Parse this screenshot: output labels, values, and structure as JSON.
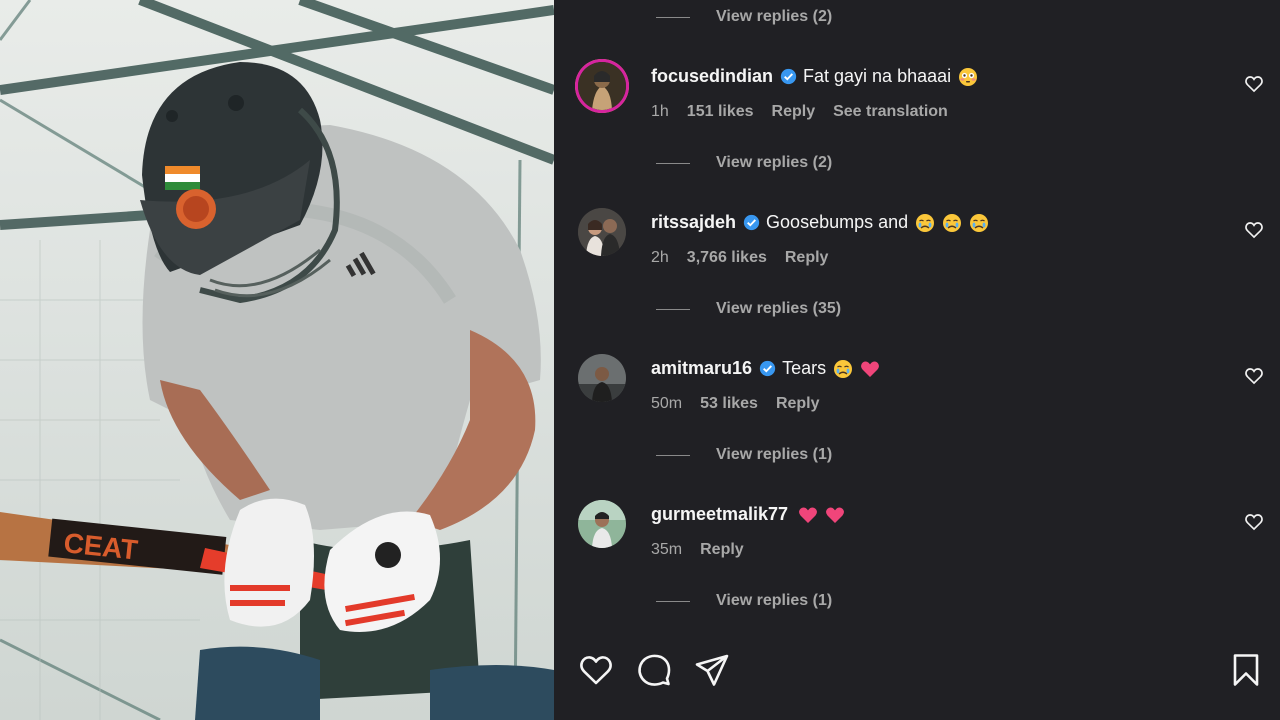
{
  "view_replies_top": "View replies (2)",
  "comments": [
    {
      "username": "focusedindian",
      "text": "Fat gayi na bhaaai",
      "emojis": [
        "flushed"
      ],
      "age": "1h",
      "likes": "151 likes",
      "reply": "Reply",
      "translate": "See translation",
      "view_replies": "View replies (2)"
    },
    {
      "username": "ritssajdeh",
      "text": "Goosebumps and",
      "emojis": [
        "crying",
        "crying",
        "crying"
      ],
      "age": "2h",
      "likes": "3,766 likes",
      "reply": "Reply",
      "view_replies": "View replies (35)"
    },
    {
      "username": "amitmaru16",
      "text": "Tears",
      "emojis": [
        "crying",
        "heart"
      ],
      "age": "50m",
      "likes": "53 likes",
      "reply": "Reply",
      "view_replies": "View replies (1)"
    },
    {
      "username": "gurmeetmalik77",
      "text": "",
      "emojis": [
        "heart",
        "heart"
      ],
      "age": "35m",
      "reply": "Reply",
      "view_replies": "View replies (1)"
    }
  ],
  "icons": {
    "like": "heart-outline-icon",
    "comment": "comment-bubble-icon",
    "share": "paper-plane-icon",
    "save": "bookmark-icon",
    "verified": "verified-badge-icon"
  },
  "colors": {
    "background": "#202024",
    "verified": "#3897f0",
    "heart_emoji": "#f0457a",
    "muted_text": "#a8a8a8"
  },
  "photo_text": {
    "bat_brand": "CEAT"
  }
}
